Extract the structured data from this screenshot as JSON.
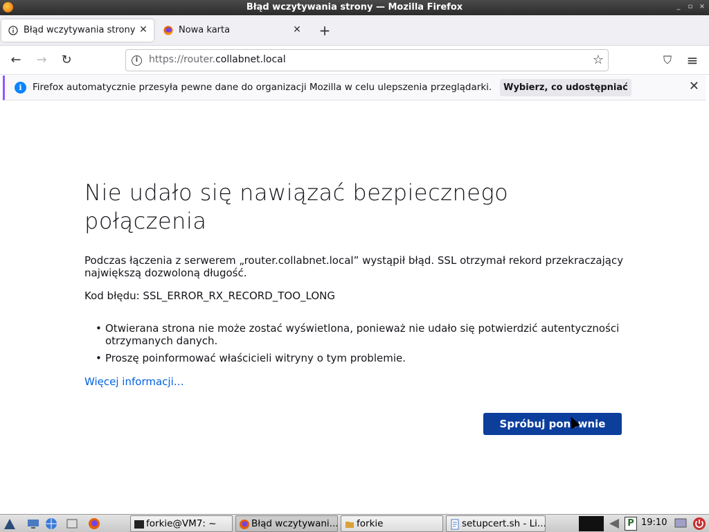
{
  "window": {
    "title": "Błąd wczytywania strony — Mozilla Firefox",
    "controls": [
      "_",
      "▫",
      "×"
    ]
  },
  "tabs": [
    {
      "label": "Błąd wczytywania strony",
      "icon": "info-icon",
      "active": true
    },
    {
      "label": "Nowa karta",
      "icon": "firefox-icon",
      "active": false
    }
  ],
  "newtab": {
    "symbol": "+"
  },
  "nav": {
    "back": "←",
    "forward": "→",
    "reload": "↻",
    "url_prefix": "https://router.",
    "url_domain": "collabnet.local",
    "star": "☆",
    "pocket": "⛉",
    "menu": "≡"
  },
  "notification": {
    "text": "Firefox automatycznie przesyła pewne dane do organizacji Mozilla w celu ulepszenia przeglądarki.",
    "button": "Wybierz, co udostępniać",
    "close": "✕",
    "accent": "#9059ff"
  },
  "error": {
    "title": "Nie udało się nawiązać bezpiecznego połączenia",
    "description": "Podczas łączenia z serwerem „router.collabnet.local” wystąpił błąd. SSL otrzymał rekord przekraczający największą dozwoloną długość.",
    "code": "Kod błędu: SSL_ERROR_RX_RECORD_TOO_LONG",
    "bullets": [
      "Otwierana strona nie może zostać wyświetlona, ponieważ nie udało się potwierdzić autentyczności otrzymanych danych.",
      "Proszę poinformować właścicieli witryny o tym problemie."
    ],
    "more_link": "Więcej informacji…",
    "retry_button": "Spróbuj ponownie",
    "retry_color": "#0c3e9c"
  },
  "taskbar": {
    "tasks": [
      {
        "label": "forkie@VM7: ~",
        "icon": "terminal-icon"
      },
      {
        "label": "Błąd wczytywani...",
        "icon": "firefox-icon",
        "active": true
      },
      {
        "label": "forkie",
        "icon": "folder-icon"
      },
      {
        "label": "setupcert.sh - Li...",
        "icon": "text-editor-icon"
      }
    ],
    "clock": "19:10"
  }
}
